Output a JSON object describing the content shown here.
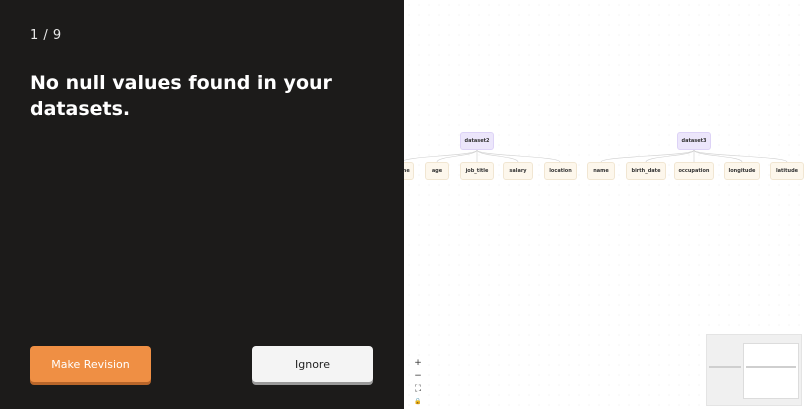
{
  "panel": {
    "step_counter": "1 / 9",
    "message": "No null values found in your datasets.",
    "make_revision_label": "Make Revision",
    "ignore_label": "Ignore"
  },
  "canvas": {
    "datasets": [
      {
        "name": "dataset2",
        "columns": [
          "name",
          "age",
          "job_title",
          "salary",
          "location"
        ]
      },
      {
        "name": "dataset3",
        "columns": [
          "name",
          "birth_date",
          "occupation",
          "longitude",
          "latitude"
        ]
      }
    ],
    "controls": [
      {
        "icon": "plus-icon",
        "glyph": "+"
      },
      {
        "icon": "minus-icon",
        "glyph": "−"
      },
      {
        "icon": "fit-view-icon",
        "glyph": "⛶"
      },
      {
        "icon": "lock-icon",
        "glyph": "🔒"
      }
    ]
  },
  "colors": {
    "panel_bg": "#1c1b1a",
    "accent": "#ef8f44",
    "parent_node": "#ece6fb",
    "child_node": "#fdf7ec"
  }
}
